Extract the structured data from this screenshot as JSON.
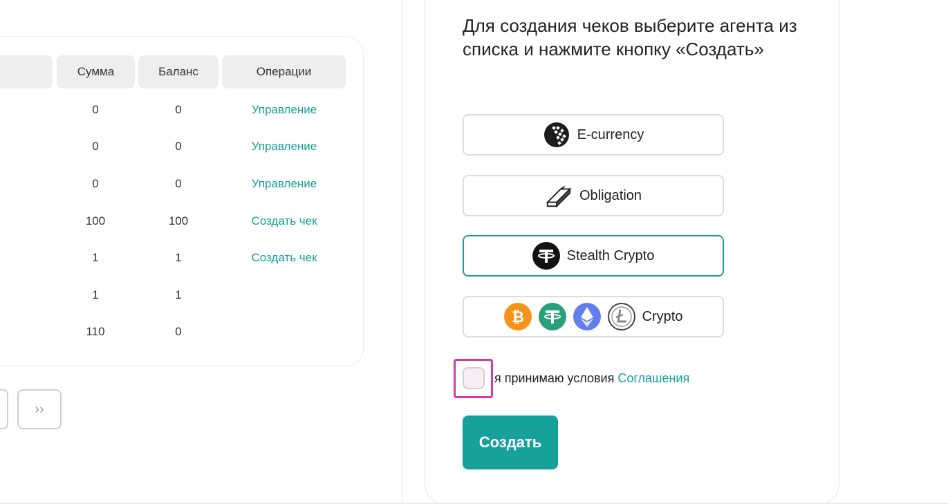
{
  "table": {
    "headers": [
      "Сумма",
      "Баланс",
      "Операции"
    ],
    "rows": [
      {
        "sum": "0",
        "balance": "0",
        "op": "Управление"
      },
      {
        "sum": "0",
        "balance": "0",
        "op": "Управление"
      },
      {
        "sum": "0",
        "balance": "0",
        "op": "Управление"
      },
      {
        "sum": "100",
        "balance": "100",
        "op": "Создать чек"
      },
      {
        "sum": "1",
        "balance": "1",
        "op": "Создать чек"
      },
      {
        "sum": "1",
        "balance": "1",
        "op": ""
      },
      {
        "sum": "110",
        "balance": "0",
        "op": ""
      }
    ]
  },
  "pager": {
    "next_label": "››"
  },
  "panel": {
    "instructions": "Для создания чеков выберите агента из списка и нажмите кнопку «Создать»",
    "agents": [
      {
        "label": "E-currency",
        "icon": "webmoney-icon"
      },
      {
        "label": "Obligation",
        "icon": "gold-bar-icon"
      },
      {
        "label": "Stealth Crypto",
        "icon": "tether-icon",
        "selected": true
      },
      {
        "label": "Crypto",
        "icons": [
          "bitcoin-icon",
          "tether-icon",
          "ethereum-icon",
          "litecoin-icon"
        ]
      }
    ],
    "agree_text": "я принимаю условия ",
    "agree_link": "Соглашения",
    "create_label": "Создать"
  },
  "colors": {
    "accent": "#16a19b",
    "highlight": "#d83aa4",
    "bitcoin": "#f7931a",
    "tether": "#26a17b",
    "ethereum": "#627eea"
  }
}
